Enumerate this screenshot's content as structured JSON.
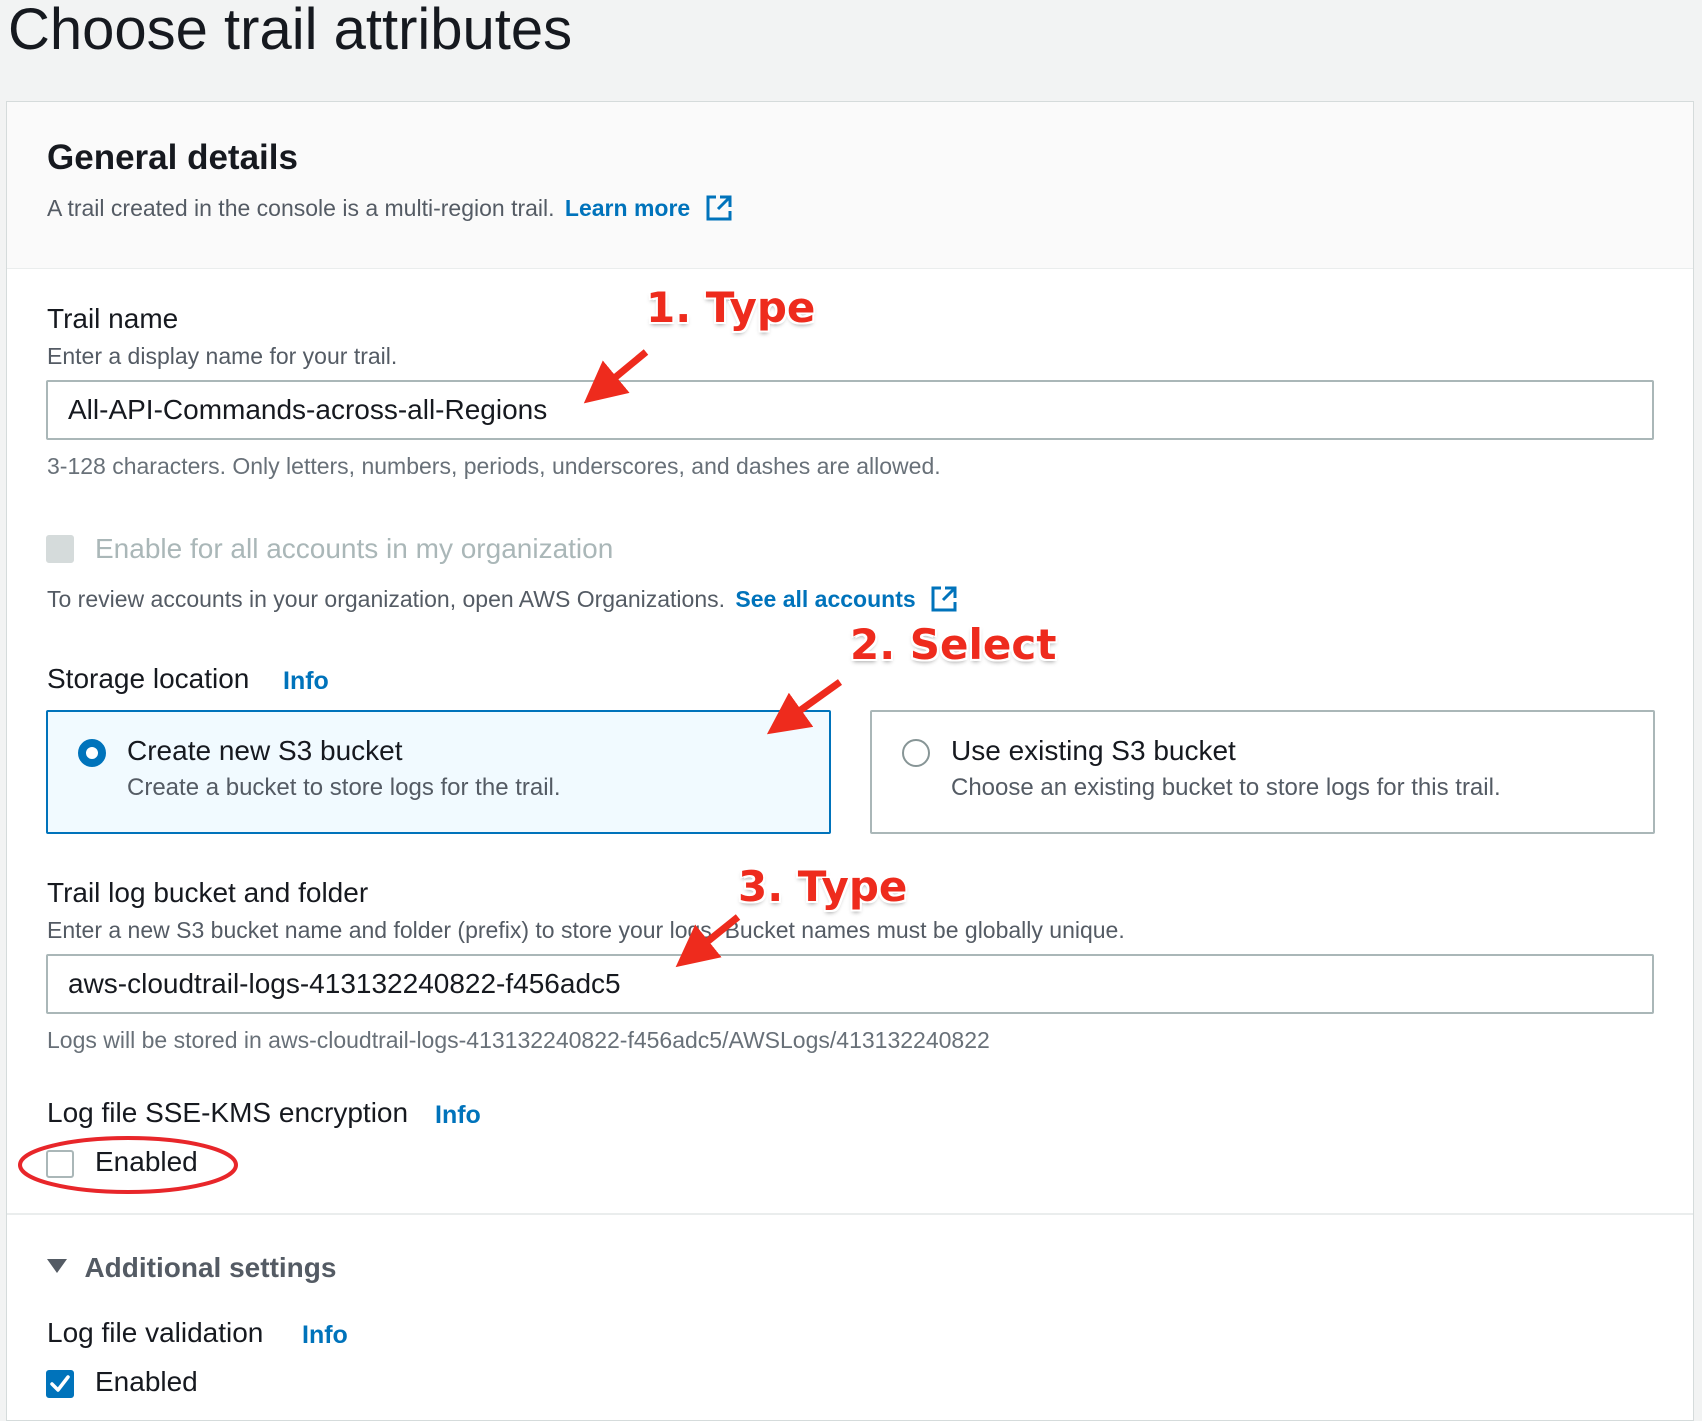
{
  "page": {
    "title": "Choose trail attributes"
  },
  "general": {
    "heading": "General details",
    "description": "A trail created in the console is a multi-region trail.",
    "learn_more": "Learn more"
  },
  "trail_name": {
    "label": "Trail name",
    "description": "Enter a display name for your trail.",
    "value": "All-API-Commands-across-all-Regions",
    "constraint": "3-128 characters. Only letters, numbers, periods, underscores, and dashes are allowed."
  },
  "organization": {
    "checkbox_label": "Enable for all accounts in my organization",
    "checked": false,
    "disabled": true,
    "note": "To review accounts in your organization, open AWS Organizations.",
    "link": "See all accounts"
  },
  "storage": {
    "label": "Storage location",
    "info": "Info",
    "options": [
      {
        "title": "Create new S3 bucket",
        "description": "Create a bucket to store logs for the trail.",
        "selected": true
      },
      {
        "title": "Use existing S3 bucket",
        "description": "Choose an existing bucket to store logs for this trail.",
        "selected": false
      }
    ]
  },
  "bucket": {
    "label": "Trail log bucket and folder",
    "description": "Enter a new S3 bucket name and folder (prefix) to store your logs. Bucket names must be globally unique.",
    "value": "aws-cloudtrail-logs-413132240822-f456adc5",
    "path_note": "Logs will be stored in aws-cloudtrail-logs-413132240822-f456adc5/AWSLogs/413132240822"
  },
  "encryption": {
    "label": "Log file SSE-KMS encryption",
    "info": "Info",
    "checkbox_label": "Enabled",
    "checked": false
  },
  "additional": {
    "heading": "Additional settings",
    "validation_label": "Log file validation",
    "info": "Info",
    "checkbox_label": "Enabled",
    "checked": true
  },
  "annotations": {
    "step1": "1. Type",
    "step2": "2. Select",
    "step3": "3. Type"
  },
  "colors": {
    "accent": "#0073bb",
    "annotation": "#ee2b1d",
    "selected_tile_bg": "#f1faff"
  },
  "icons": {
    "external_link": "external-link-icon",
    "caret": "caret-down-icon",
    "checkmark": "checkmark-icon"
  }
}
